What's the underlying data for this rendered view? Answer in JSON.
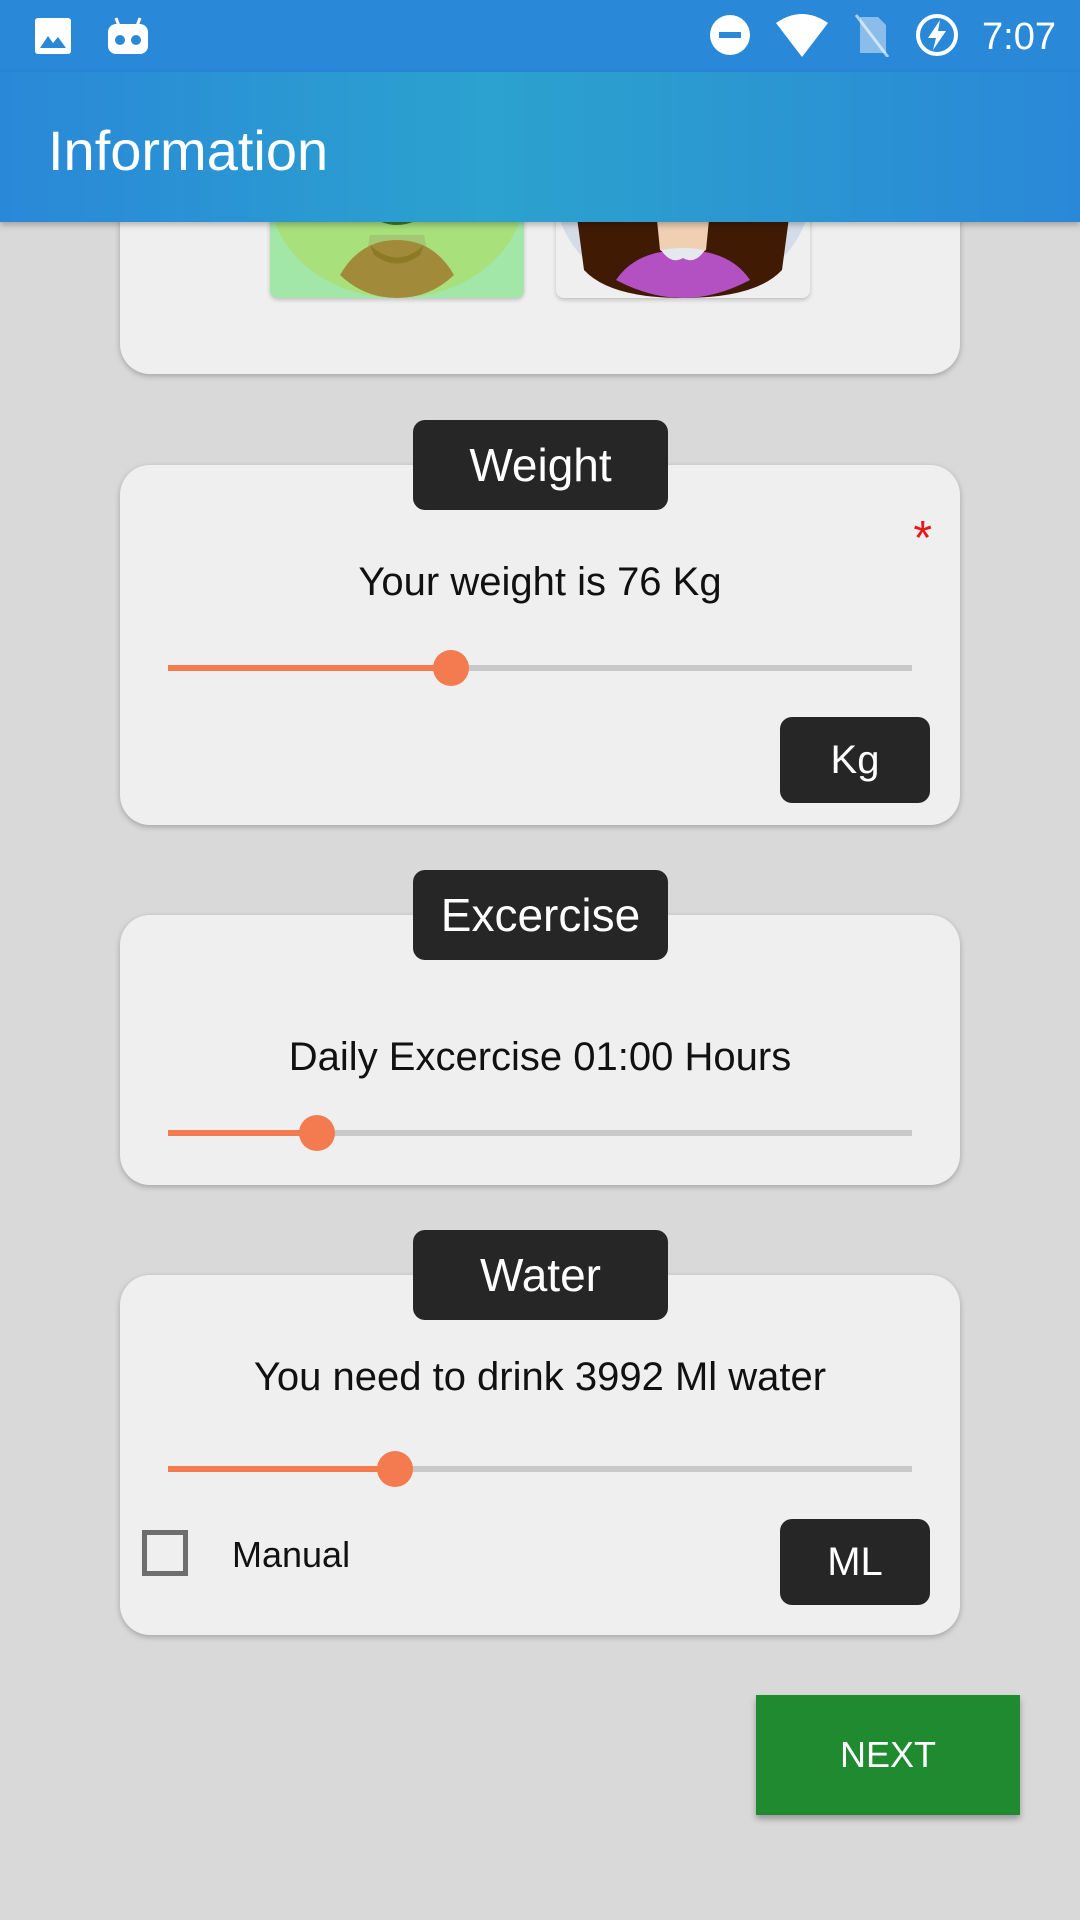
{
  "status_bar": {
    "time": "7:07",
    "left_icons": [
      "image-icon",
      "cyanogen-bot-icon"
    ],
    "right_icons": [
      "do-not-disturb-icon",
      "wifi-icon",
      "no-sim-icon",
      "battery-charging-icon"
    ]
  },
  "app_bar": {
    "title": "Information"
  },
  "gender": {
    "options": [
      {
        "name": "male-avatar",
        "selected": true
      },
      {
        "name": "female-avatar",
        "selected": false
      }
    ]
  },
  "weight": {
    "label": "Weight",
    "text": "Your weight is 76 Kg",
    "value": 76,
    "slider_fraction": 0.38,
    "required_mark": "*",
    "unit_button": "Kg"
  },
  "exercise": {
    "label": "Excercise",
    "text": "Daily Excercise 01:00 Hours",
    "value": "01:00",
    "slider_fraction": 0.2
  },
  "water": {
    "label": "Water",
    "text": "You need to drink 3992 Ml water",
    "value": 3992,
    "slider_fraction": 0.305,
    "manual_label": "Manual",
    "manual_checked": false,
    "unit_button": "ML"
  },
  "next_button": "NEXT",
  "colors": {
    "accent": "#f47a4f",
    "track": "#c9c9c9",
    "next": "#1f8a2f",
    "app_bar": "#2a88d8",
    "chip": "#262626",
    "required": "#e31b1b"
  }
}
